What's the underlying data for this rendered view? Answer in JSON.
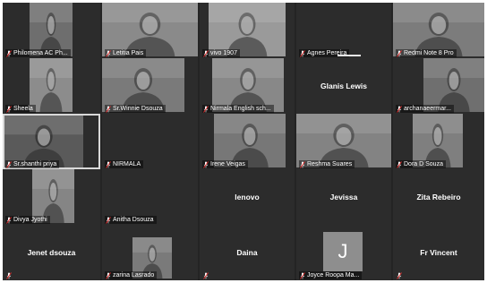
{
  "participants": [
    {
      "name": "Philomena AC Ph...",
      "type": "video",
      "muted": true
    },
    {
      "name": "Letitia Pais",
      "type": "video",
      "muted": true
    },
    {
      "name": "vivo 1907",
      "type": "video",
      "muted": true
    },
    {
      "name": "Agnes Pereira",
      "type": "name",
      "muted": true
    },
    {
      "name": "Redmi Note 8 Pro",
      "type": "video",
      "muted": true
    },
    {
      "name": "Sheela",
      "type": "video",
      "muted": true
    },
    {
      "name": "Sr.Winnie Dsouza",
      "type": "video",
      "muted": true
    },
    {
      "name": "Nirmala English sch...",
      "type": "video",
      "muted": true
    },
    {
      "name": "Glanis Lewis",
      "type": "name",
      "muted": false
    },
    {
      "name": "archanaeermar...",
      "type": "video",
      "muted": true
    },
    {
      "name": "Sr.shanthi priya",
      "type": "video",
      "muted": true,
      "active": true
    },
    {
      "name": "NIRMALA",
      "type": "name",
      "muted": true
    },
    {
      "name": "Irene Veigas",
      "type": "video",
      "muted": true
    },
    {
      "name": "Reshma Suares",
      "type": "video",
      "muted": true
    },
    {
      "name": "Dora D Souza",
      "type": "video",
      "muted": true
    },
    {
      "name": "Divya Jyothi",
      "type": "video",
      "muted": true
    },
    {
      "name": "Anitha Dsouza",
      "type": "name",
      "muted": true
    },
    {
      "name": "lenovo",
      "type": "name",
      "muted": false
    },
    {
      "name": "Jevissa",
      "type": "name",
      "muted": false
    },
    {
      "name": "Zita Rebeiro",
      "type": "name",
      "muted": false
    },
    {
      "name": "Jenet dsouza",
      "type": "name",
      "muted": true
    },
    {
      "name": "zarina Lasrado",
      "type": "video",
      "muted": true
    },
    {
      "name": "Daina",
      "type": "name",
      "muted": true
    },
    {
      "name": "Joyce Roopa Ma...",
      "type": "avatar",
      "avatar_letter": "J",
      "muted": true
    },
    {
      "name": "Fr Vincent",
      "type": "name",
      "muted": true
    }
  ]
}
